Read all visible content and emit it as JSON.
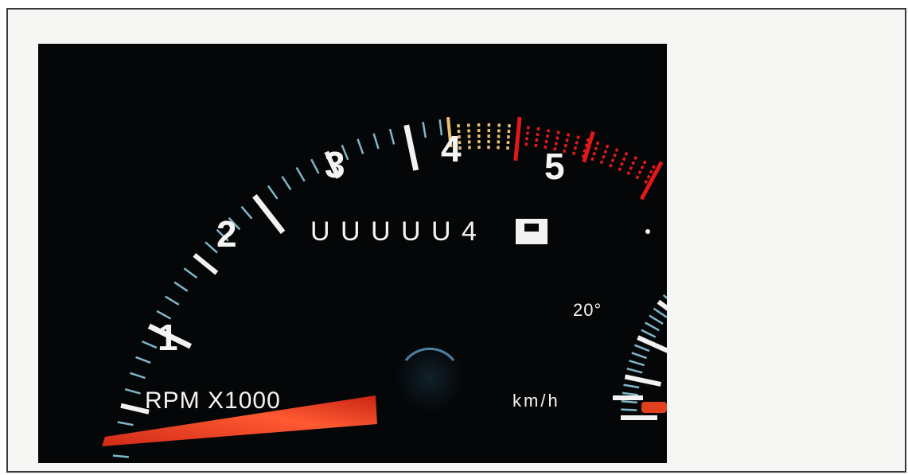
{
  "tachometer": {
    "dial_numbers": [
      "1",
      "2",
      "3",
      "4",
      "5"
    ],
    "unit_label": "RPM X1000",
    "odometer_digits": [
      "U",
      "U",
      "U",
      "U",
      "U",
      "4"
    ]
  },
  "speedometer": {
    "temp_reading": "20°",
    "unit_label": "km/h"
  },
  "colors": {
    "background": "#050607",
    "tick_white": "#f2f2f2",
    "tick_blue": "#7fb6c8",
    "caution_yellow": "#e8c070",
    "redline": "#e01818",
    "needle": "#ee4020"
  }
}
